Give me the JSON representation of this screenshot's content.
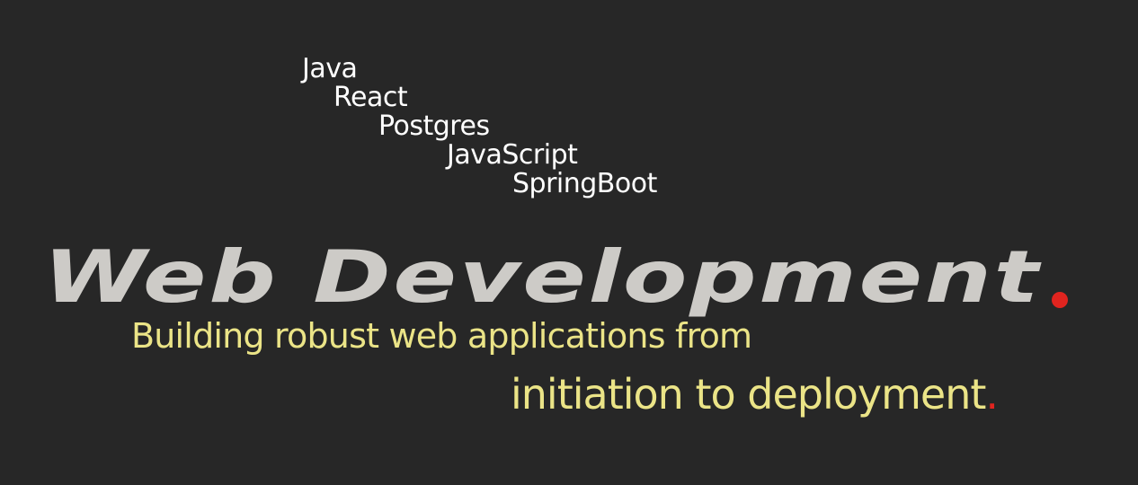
{
  "technologies": [
    "Java",
    "React",
    "Postgres",
    "JavaScript",
    "SpringBoot"
  ],
  "headline": {
    "text": "Web Development",
    "period": "."
  },
  "tagline": {
    "line1": "Building robust web applications from",
    "line2": "initiation to deployment",
    "period": "."
  },
  "colors": {
    "background": "#272727",
    "technology_text": "#ffffff",
    "headline": "#cdcbc7",
    "accent": "#e0241f",
    "tagline": "#ebe487"
  }
}
